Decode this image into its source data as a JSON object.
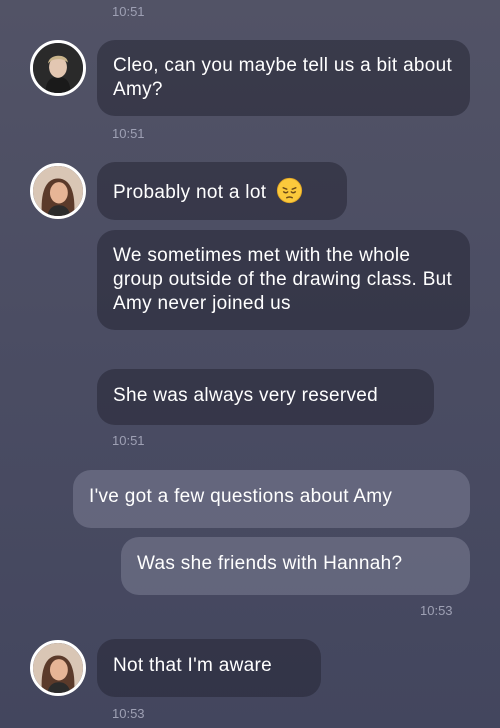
{
  "timestamps": [
    "10:51",
    "10:51",
    "10:51",
    "10:53",
    "10:53"
  ],
  "messages": [
    {
      "text": "Cleo, can you maybe tell us a bit about Amy?"
    },
    {
      "text": "Probably not a lot",
      "emoji": "pensive-face"
    },
    {
      "text": "We sometimes met with the whole group outside of the drawing class. But Amy never joined us"
    },
    {
      "text": "She was always very reserved"
    },
    {
      "text": "I've got a few questions about Amy"
    },
    {
      "text": "Was she friends with Hannah?"
    },
    {
      "text": "Not that I'm aware"
    }
  ],
  "icons": {
    "emoji": "pensive-face-emoji"
  },
  "colors": {
    "background": "#4b4d63",
    "incoming_bubble": "#3a3b4d",
    "outgoing_bubble": "#6b6d85",
    "timestamp": "#9ea0b4"
  }
}
